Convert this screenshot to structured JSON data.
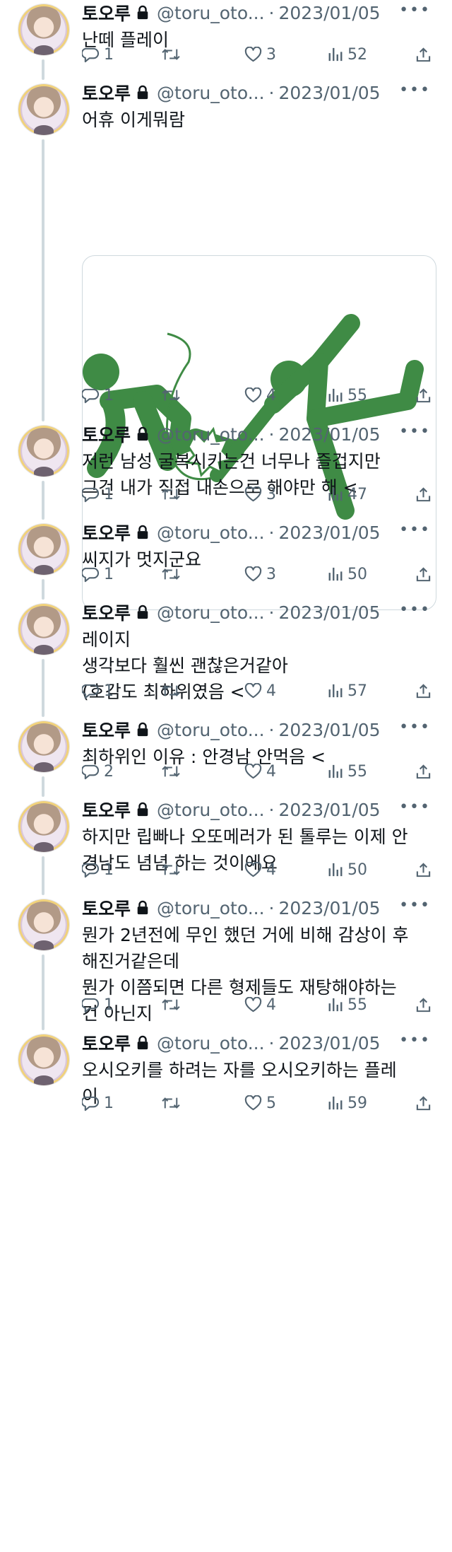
{
  "tweets": [
    {
      "name": "토오루",
      "handle": "@toru_oto...",
      "date": "2023/01/05",
      "text": "난떼 플레이",
      "replies": "1",
      "likes": "3",
      "views": "52"
    },
    {
      "name": "토오루",
      "handle": "@toru_oto...",
      "date": "2023/01/05",
      "text": "어휴 이게뭐람",
      "replies": "1",
      "likes": "4",
      "views": "55",
      "has_media": true
    },
    {
      "name": "토오루",
      "handle": "@toru_oto...",
      "date": "2023/01/05",
      "text": "저런 남성 굴복시키는건 너무나 즐겁지만\n그건 내가 직접 내손으로 해야만 해 <",
      "replies": "1",
      "likes": "3",
      "views": "47"
    },
    {
      "name": "토오루",
      "handle": "@toru_oto...",
      "date": "2023/01/05",
      "text": "씨지가 멋지군요",
      "replies": "1",
      "likes": "3",
      "views": "50"
    },
    {
      "name": "토오루",
      "handle": "@toru_oto...",
      "date": "2023/01/05",
      "text": "레이지\n생각보다 훨씬 괜찮은거같아\n(호감도 최하위였음 <",
      "replies": "1",
      "likes": "4",
      "views": "57"
    },
    {
      "name": "토오루",
      "handle": "@toru_oto...",
      "date": "2023/01/05",
      "text": "최하위인 이유 : 안경남 안먹음 <",
      "replies": "2",
      "likes": "4",
      "views": "55"
    },
    {
      "name": "토오루",
      "handle": "@toru_oto...",
      "date": "2023/01/05",
      "text": "하지만 립빠나 오또메러가 된 톨루는 이제 안\n경남도 념념 하는 것이에요",
      "replies": "1",
      "likes": "4",
      "views": "50"
    },
    {
      "name": "토오루",
      "handle": "@toru_oto...",
      "date": "2023/01/05",
      "text": "뭔가 2년전에 무인 했던 거에 비해 감상이 후\n해진거같은데\n뭔가 이쯤되면 다른 형제들도 재탕해야하는\n건 아닌지",
      "replies": "1",
      "likes": "4",
      "views": "55"
    },
    {
      "name": "토오루",
      "handle": "@toru_oto...",
      "date": "2023/01/05",
      "text": "오시오키를 하려는 자를 오시오키하는 플레\n이",
      "replies": "1",
      "likes": "5",
      "views": "59"
    }
  ],
  "separator": "·",
  "more_glyph": "•••",
  "colors": {
    "muted": "#536471",
    "line": "#cfd9de",
    "figure_green": "#3f8b45"
  },
  "icons": [
    "lock-icon",
    "more-icon",
    "reply-icon",
    "retweet-icon",
    "like-icon",
    "views-icon",
    "share-icon"
  ]
}
